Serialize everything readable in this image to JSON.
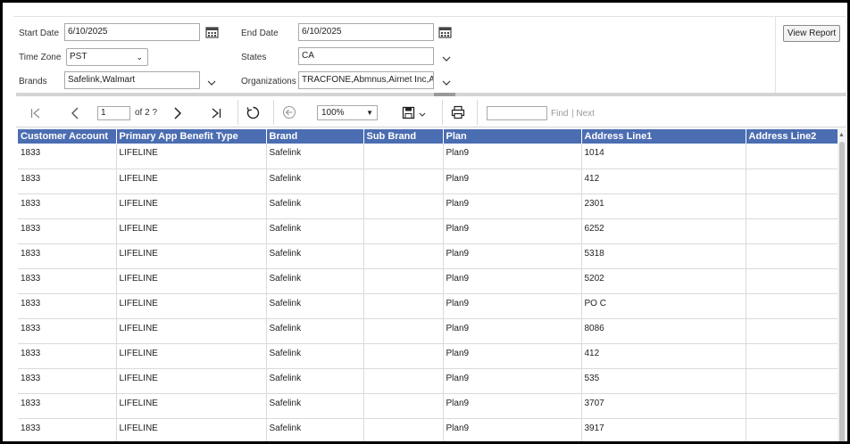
{
  "parameters": {
    "start_date": {
      "label": "Start Date",
      "value": "6/10/2025"
    },
    "end_date": {
      "label": "End Date",
      "value": "6/10/2025"
    },
    "time_zone": {
      "label": "Time Zone",
      "value": "PST"
    },
    "states": {
      "label": "States",
      "value": "CA"
    },
    "brands": {
      "label": "Brands",
      "value": "Safelink,Walmart"
    },
    "organizations": {
      "label": "Organizations",
      "value": "TRACFONE,Abmnus,Airnet Inc,AM"
    },
    "view_report_label": "View Report"
  },
  "toolbar": {
    "page_number": "1",
    "page_of": "of 2 ?",
    "zoom": "100%",
    "find_label": "Find",
    "next_label": "| Next"
  },
  "table": {
    "columns": [
      "Customer Account",
      "Primary App Benefit Type",
      "Brand",
      "Sub Brand",
      "Plan",
      "Address Line1",
      "Address Line2"
    ],
    "rows": [
      [
        "1833",
        "LIFELINE",
        "Safelink",
        "",
        "Plan9",
        "1014",
        ""
      ],
      [
        "1833",
        "LIFELINE",
        "Safelink",
        "",
        "Plan9",
        "412",
        ""
      ],
      [
        "1833",
        "LIFELINE",
        "Safelink",
        "",
        "Plan9",
        "2301",
        ""
      ],
      [
        "1833",
        "LIFELINE",
        "Safelink",
        "",
        "Plan9",
        "6252",
        ""
      ],
      [
        "1833",
        "LIFELINE",
        "Safelink",
        "",
        "Plan9",
        "5318",
        ""
      ],
      [
        "1833",
        "LIFELINE",
        "Safelink",
        "",
        "Plan9",
        "5202",
        ""
      ],
      [
        "1833",
        "LIFELINE",
        "Safelink",
        "",
        "Plan9",
        "PO C",
        ""
      ],
      [
        "1833",
        "LIFELINE",
        "Safelink",
        "",
        "Plan9",
        "8086",
        ""
      ],
      [
        "1833",
        "LIFELINE",
        "Safelink",
        "",
        "Plan9",
        "412",
        ""
      ],
      [
        "1833",
        "LIFELINE",
        "Safelink",
        "",
        "Plan9",
        "535",
        ""
      ],
      [
        "1833",
        "LIFELINE",
        "Safelink",
        "",
        "Plan9",
        "3707",
        ""
      ],
      [
        "1833",
        "LIFELINE",
        "Safelink",
        "",
        "Plan9",
        "3917",
        ""
      ]
    ]
  },
  "colors": {
    "header_bg": "#4b6db1",
    "header_text": "#ffffff"
  },
  "icons": [
    "calendar-icon",
    "chevron-down-icon",
    "first-page-icon",
    "previous-page-icon",
    "next-page-icon",
    "last-page-icon",
    "refresh-icon",
    "back-icon",
    "save-icon",
    "print-icon"
  ]
}
